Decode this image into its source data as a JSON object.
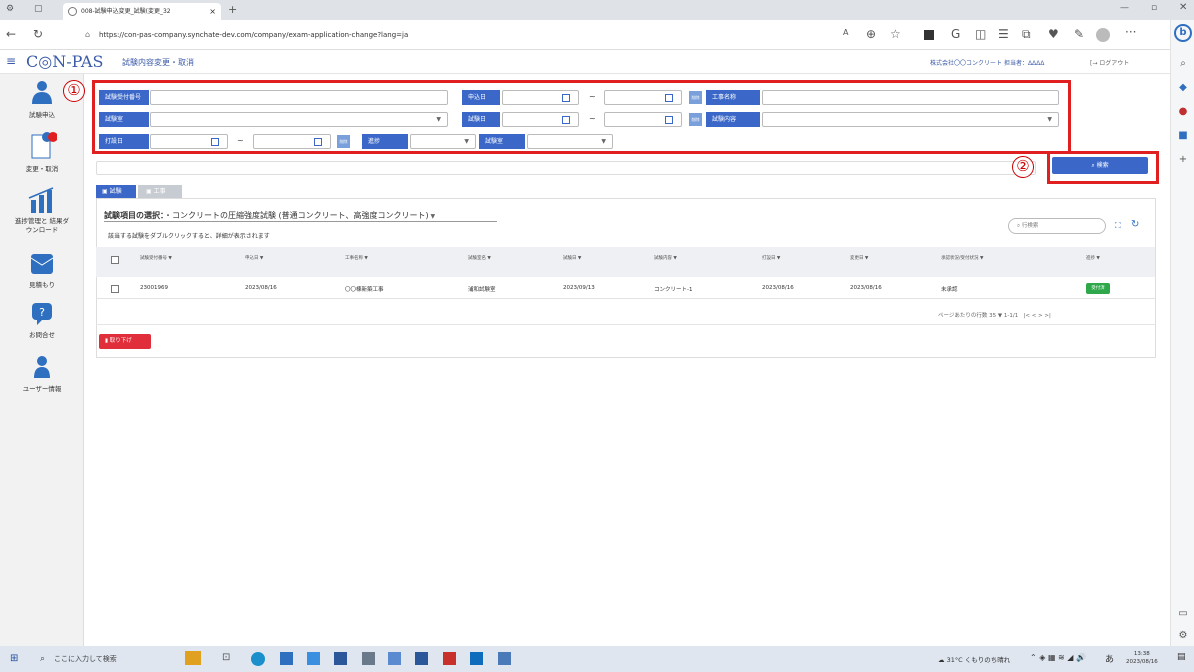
{
  "browser": {
    "tab_title": "008-試験申込変更_試験(変更_32",
    "url": "https://con-pas-company.synchate-dev.com/company/exam-application-change?lang=ja",
    "new_tab": "+",
    "tab_close": "×"
  },
  "app": {
    "logo": "C◎N-PAS",
    "page_title": "試験内容変更・取消",
    "company": "株式会社〇〇コンクリート",
    "person_label": "担当者：",
    "person": "ΔΔΔΔ",
    "logout": "ログアウト",
    "menu_icon": "≡"
  },
  "sidebar": [
    {
      "label": "試験申込",
      "icon": "person-icon"
    },
    {
      "label": "変更・取消",
      "icon": "doc-edit-icon"
    },
    {
      "label": "進捗管理と 結果ダ\nウンロード",
      "icon": "bar-chart-icon"
    },
    {
      "label": "見積もり",
      "icon": "envelope-icon"
    },
    {
      "label": "お問合せ",
      "icon": "question-icon"
    },
    {
      "label": "ユーザー情報",
      "icon": "user-icon"
    }
  ],
  "filters": {
    "exam_number": "試験受付番号",
    "apply_date": "申込日",
    "project_name": "工事名称",
    "lab": "試験室",
    "exam_date": "試験日",
    "exam_content": "試験内容",
    "cast_date": "打設日",
    "progress": "進捗",
    "lab2": "試験室",
    "clear": "削除",
    "tilde": "~"
  },
  "annotations": {
    "one": "①",
    "two": "②"
  },
  "search_button": "検索",
  "tabs": [
    {
      "label": "試験"
    },
    {
      "label": "工事"
    }
  ],
  "selection": {
    "title": "試験項目の選択：",
    "value": "・コンクリートの圧縮強度試験 (普通コンクリート、高強度コンクリート)",
    "hint": "該当する試験をダブルクリックすると、詳細が表示されます",
    "search_placeholder": "行検索"
  },
  "table": {
    "headers": [
      "試験受付番号",
      "申込日",
      "工事名称",
      "試験室名",
      "試験日",
      "試験内容",
      "打設日",
      "変更日",
      "承認状況/受付状況",
      "進捗"
    ],
    "row": [
      "23001969",
      "2023/08/16",
      "〇〇棟新築工事",
      "浦和試験室",
      "2023/09/13",
      "コンクリート-1",
      "2023/08/16",
      "2023/08/16",
      "未承認",
      "受付済"
    ]
  },
  "pagination": {
    "rows_label": "ページあたりの行数",
    "rows": "35",
    "range": "1-1/1",
    "controls": "|<  <  >  >|"
  },
  "withdraw_button": "取り下げ",
  "taskbar": {
    "search": "ここに入力して検索",
    "weather": "31°C くもりのち晴れ",
    "time": "13:38",
    "date": "2023/08/16",
    "ime": "あ"
  },
  "colors": {
    "brand": "#3b68c8",
    "annotation": "#e02020",
    "status": "#2ea84a"
  }
}
